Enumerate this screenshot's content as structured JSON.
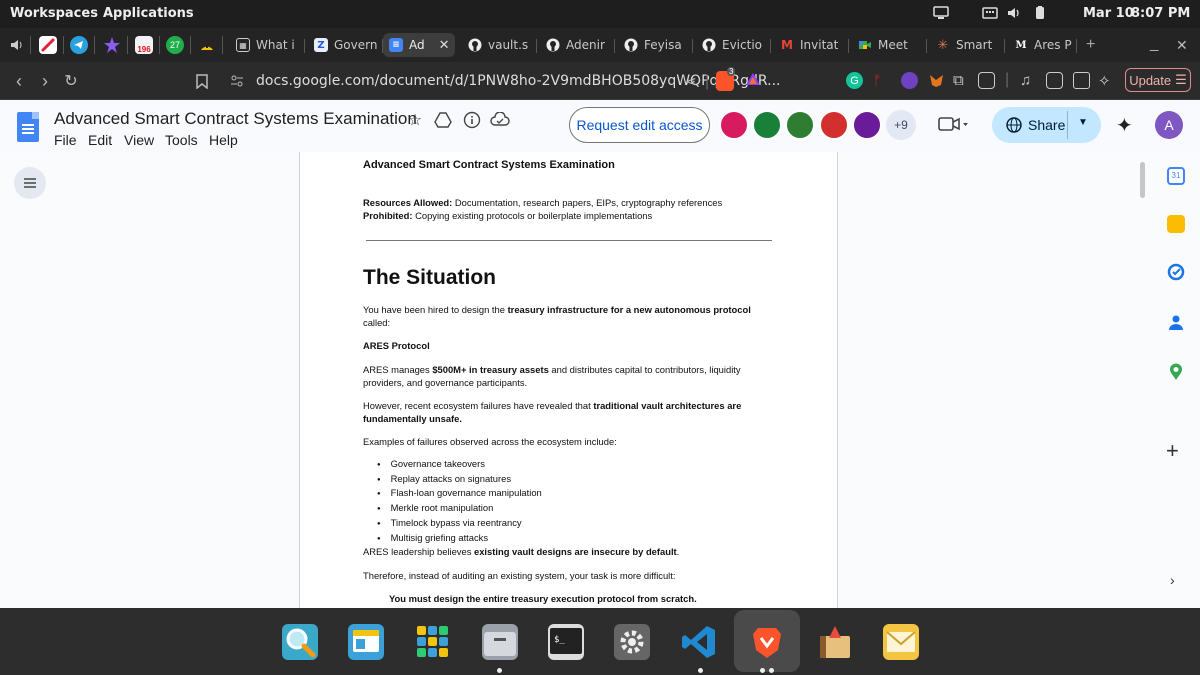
{
  "os": {
    "workspaces": "Workspaces",
    "applications": "Applications",
    "date": "Mar 10",
    "time": "8:07 PM"
  },
  "tabs": [
    {
      "label": "What i",
      "favicon": "grid-icon"
    },
    {
      "label": "Govern",
      "favicon": "z-icon"
    },
    {
      "label": "Ad",
      "favicon": "docs-icon",
      "active": true
    },
    {
      "label": "vault.s",
      "favicon": "github-icon"
    },
    {
      "label": "Adenir",
      "favicon": "github-icon"
    },
    {
      "label": "Feyisa",
      "favicon": "github-icon"
    },
    {
      "label": "Evictio",
      "favicon": "github-icon"
    },
    {
      "label": "Invitat",
      "favicon": "gmail-icon"
    },
    {
      "label": "Meet",
      "favicon": "meet-icon"
    },
    {
      "label": "Smart",
      "favicon": "claude-icon"
    },
    {
      "label": "Ares P",
      "favicon": "medium-icon"
    }
  ],
  "pinned_badges": {
    "first": "196",
    "second": "27"
  },
  "nav": {
    "url": "docs.google.com/document/d/1PNW8ho-2V9mdBHOB508yqWQPqjkRgdR...",
    "brave_badge": "3",
    "update_label": "Update"
  },
  "docs": {
    "title": "Advanced Smart Contract Systems Examination",
    "menu": [
      "File",
      "Edit",
      "View",
      "Tools",
      "Help"
    ],
    "request_edit": "Request edit access",
    "more_collaborators": "+9",
    "share": "Share",
    "user_initial": "A"
  },
  "page": {
    "heading_small": "Advanced Smart Contract Systems Examination",
    "resources_label": "Resources Allowed:",
    "resources_text": " Documentation, research papers, EIPs, cryptography references",
    "prohibited_label": "Prohibited:",
    "prohibited_text": " Copying existing protocols or boilerplate implementations",
    "section_title": "The Situation",
    "p1_a": "You have been hired to design the ",
    "p1_b": "treasury infrastructure for a new autonomous protocol",
    "p1_c": " called:",
    "protocol_name": "ARES Protocol",
    "p2_a": "ARES manages ",
    "p2_b": "$500M+ in treasury assets",
    "p2_c": " and distributes capital to contributors, liquidity providers, and governance participants.",
    "p3_a": "However, recent ecosystem failures have revealed that ",
    "p3_b": "traditional vault architectures are fundamentally unsafe.",
    "p4": "Examples of failures observed across the ecosystem include:",
    "failures": [
      "Governance takeovers",
      "Replay attacks on signatures",
      "Flash-loan governance manipulation",
      "Merkle root manipulation",
      "Timelock bypass via reentrancy",
      "Multisig griefing attacks"
    ],
    "p5_a": "ARES leadership believes ",
    "p5_b": "existing vault designs are insecure by default",
    "p5_c": ".",
    "p6": "Therefore, instead of auditing an existing system, your task is more difficult:",
    "p7": "You must design the entire treasury execution protocol from scratch."
  },
  "colors": {
    "docs_blue": "#4285f4",
    "share_bg": "#c2e7ff",
    "request_text": "#0b57d0"
  }
}
